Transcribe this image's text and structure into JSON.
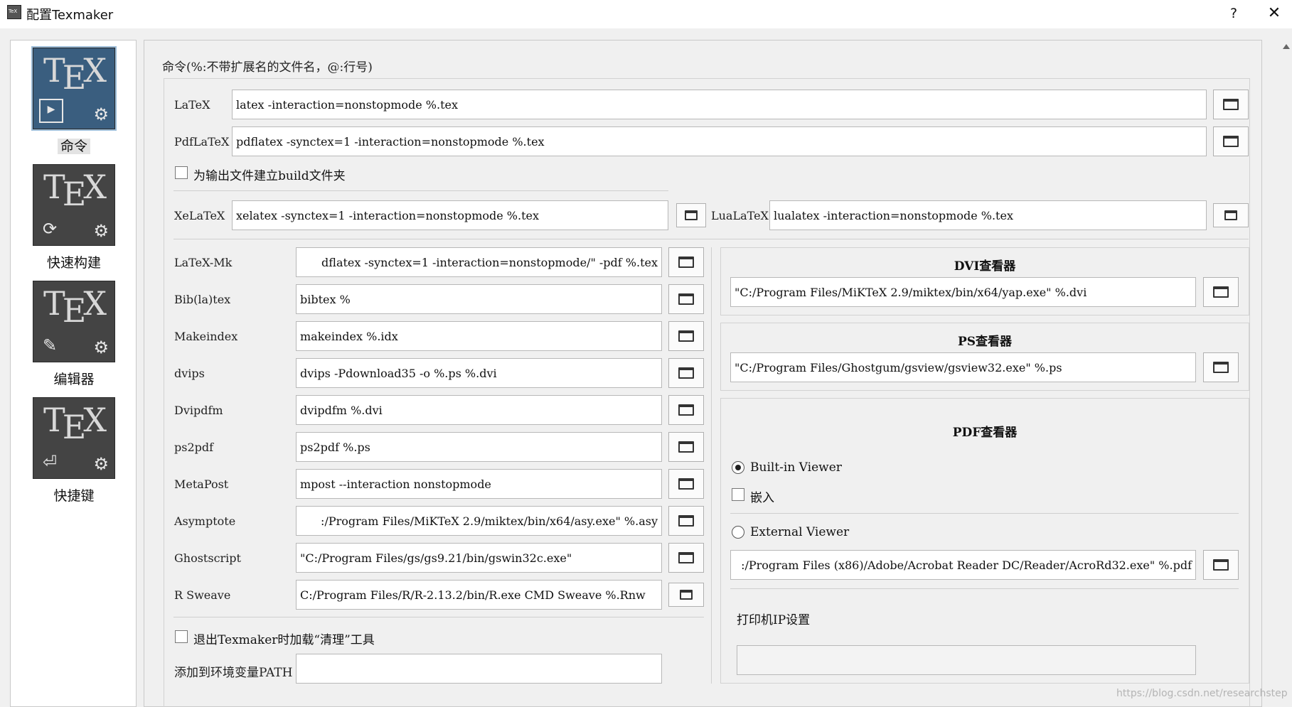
{
  "window": {
    "title": "配置Texmaker",
    "help": "?",
    "close": "✕"
  },
  "sidebar": {
    "items": [
      {
        "label": "命令",
        "sub_icon": "▶",
        "selected": true
      },
      {
        "label": "快速构建",
        "sub_icon": "⟳",
        "selected": false
      },
      {
        "label": "编辑器",
        "sub_icon": "✎",
        "selected": false
      },
      {
        "label": "快捷键",
        "sub_icon": "⏎",
        "selected": false
      }
    ],
    "logo_text": "TEX"
  },
  "commands": {
    "group_title": "命令(%:不带扩展名的文件名，@:行号)",
    "latex": {
      "label": "LaTeX",
      "value": "latex -interaction=nonstopmode %.tex"
    },
    "pdflatex": {
      "label": "PdfLaTeX",
      "value": "pdflatex -synctex=1 -interaction=nonstopmode %.tex"
    },
    "build_folder": {
      "label": "为输出文件建立build文件夹",
      "checked": false
    },
    "xelatex": {
      "label": "XeLaTeX",
      "value": "xelatex -synctex=1 -interaction=nonstopmode %.tex"
    },
    "lualatex": {
      "label": "LuaLaTeX",
      "value": "lualatex -interaction=nonstopmode %.tex"
    },
    "latexmk": {
      "label": "LaTeX-Mk",
      "value": "dflatex -synctex=1 -interaction=nonstopmode/\" -pdf %.tex"
    },
    "bibtex": {
      "label": "Bib(la)tex",
      "value": "bibtex %"
    },
    "makeindex": {
      "label": "Makeindex",
      "value": "makeindex %.idx"
    },
    "dvips": {
      "label": "dvips",
      "value": "dvips -Pdownload35 -o %.ps %.dvi"
    },
    "dvipdfm": {
      "label": "Dvipdfm",
      "value": "dvipdfm %.dvi"
    },
    "ps2pdf": {
      "label": "ps2pdf",
      "value": "ps2pdf %.ps"
    },
    "metapost": {
      "label": "MetaPost",
      "value": "mpost --interaction nonstopmode"
    },
    "asymptote": {
      "label": "Asymptote",
      "value": ":/Program Files/MiKTeX 2.9/miktex/bin/x64/asy.exe\" %.asy"
    },
    "ghostscript": {
      "label": "Ghostscript",
      "value": "\"C:/Program Files/gs/gs9.21/bin/gswin32c.exe\""
    },
    "rsweave": {
      "label": "R Sweave",
      "value": "C:/Program Files/R/R-2.13.2/bin/R.exe CMD Sweave %.Rnw"
    },
    "clean_on_exit": {
      "label": "退出Texmaker时加载“清理”工具",
      "checked": false
    },
    "env_path": {
      "label": "添加到环境变量PATH",
      "value": ""
    }
  },
  "viewers": {
    "dvi": {
      "title": "DVI查看器",
      "value": "\"C:/Program Files/MiKTeX 2.9/miktex/bin/x64/yap.exe\" %.dvi"
    },
    "ps": {
      "title": "PS查看器",
      "value": "\"C:/Program Files/Ghostgum/gsview/gsview32.exe\" %.ps"
    },
    "pdf": {
      "title": "PDF查看器",
      "builtin": {
        "label": "Built-in Viewer",
        "selected": true
      },
      "embed": {
        "label": "嵌入",
        "checked": false
      },
      "external": {
        "label": "External Viewer",
        "selected": false
      },
      "value": ":/Program Files (x86)/Adobe/Acrobat Reader DC/Reader/AcroRd32.exe\" %.pdf",
      "printer_label": "打印机IP设置",
      "printer_value": ""
    }
  },
  "watermark": "https://blog.csdn.net/researchstep",
  "colors": {
    "selected_item": "#3a5e7f",
    "item_bg": "#444444",
    "background": "#f0f0f0"
  }
}
